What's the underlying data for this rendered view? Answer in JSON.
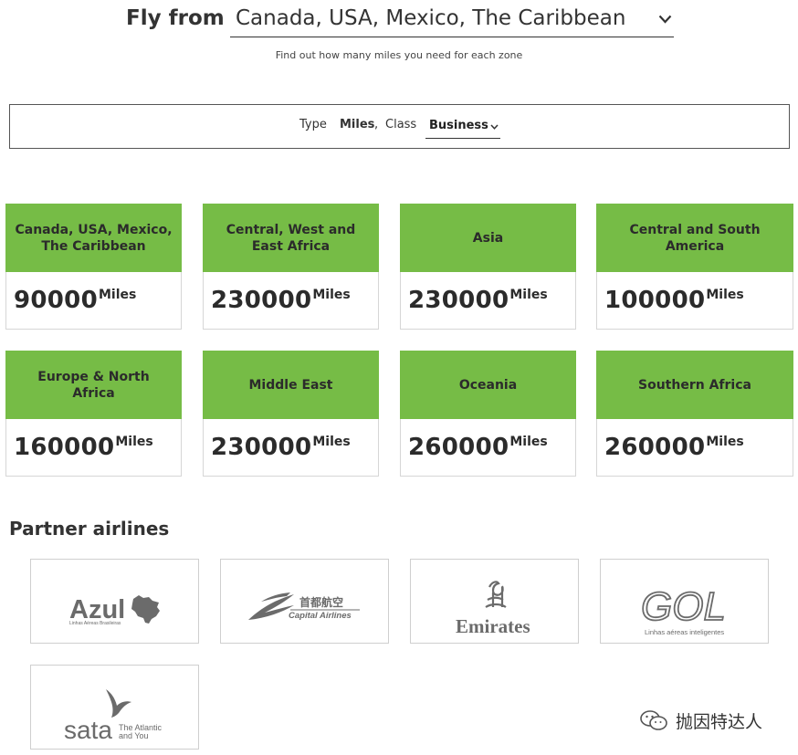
{
  "header": {
    "fly_label": "Fly from",
    "origin_value": "Canada, USA, Mexico, The Caribbean",
    "subtitle": "Find out how many miles you need for each zone"
  },
  "filters": {
    "type_label": "Type",
    "type_value": "Miles",
    "separator": ",",
    "class_label": "Class",
    "class_value": "Business"
  },
  "zones": [
    {
      "name": "Canada, USA, Mexico, The Caribbean",
      "miles": "90000",
      "unit": "Miles"
    },
    {
      "name": "Central, West and East Africa",
      "miles": "230000",
      "unit": "Miles"
    },
    {
      "name": "Asia",
      "miles": "230000",
      "unit": "Miles"
    },
    {
      "name": "Central and South America",
      "miles": "100000",
      "unit": "Miles"
    },
    {
      "name": "Europe & North Africa",
      "miles": "160000",
      "unit": "Miles"
    },
    {
      "name": "Middle East",
      "miles": "230000",
      "unit": "Miles"
    },
    {
      "name": "Oceania",
      "miles": "260000",
      "unit": "Miles"
    },
    {
      "name": "Southern Africa",
      "miles": "260000",
      "unit": "Miles"
    }
  ],
  "partners": {
    "title": "Partner airlines",
    "azul": {
      "name": "Azul",
      "tagline": "Linhas Aéreas Brasileiras"
    },
    "capital": {
      "name_cn": "首都航空",
      "name_en": "Capital Airlines"
    },
    "emirates": {
      "name": "Emirates"
    },
    "gol": {
      "name": "GOL",
      "tagline": "Linhas aéreas inteligentes"
    },
    "sata": {
      "name": "sata",
      "tagline_1": "The Atlantic",
      "tagline_2": "and You"
    }
  },
  "watermark": {
    "icon": "wechat-icon",
    "text": "抛因特达人"
  },
  "colors": {
    "zone_header": "#76bc46",
    "logo_gray": "#6b6b6b"
  }
}
